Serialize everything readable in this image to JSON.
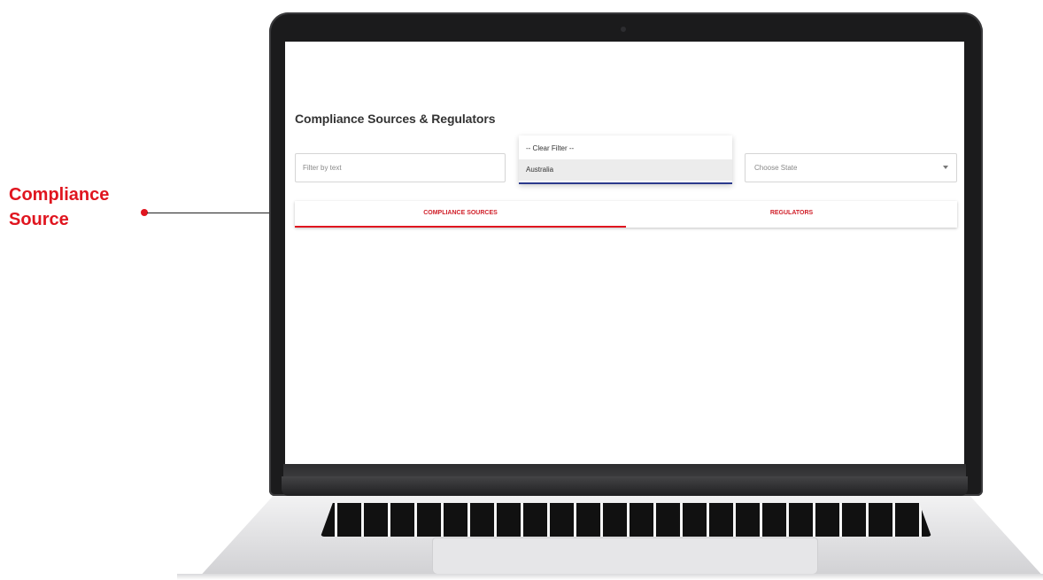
{
  "callout": {
    "label_line1": "Compliance",
    "label_line2": "Source"
  },
  "page": {
    "title": "Compliance Sources & Regulators"
  },
  "filters": {
    "text_placeholder": "Filter by text",
    "country_options": [
      "-- Clear Filter --",
      "Australia"
    ],
    "country_selected": "Australia",
    "state_placeholder": "Choose State"
  },
  "tabs": [
    {
      "label": "COMPLIANCE SOURCES",
      "active": true
    },
    {
      "label": "REGULATORS",
      "active": false
    }
  ],
  "colors": {
    "accent": "#e0151f",
    "dropdown_underline": "#2b3a8c"
  },
  "icons": {
    "state_select": "chevron-down-icon",
    "callout": "dot-icon"
  }
}
